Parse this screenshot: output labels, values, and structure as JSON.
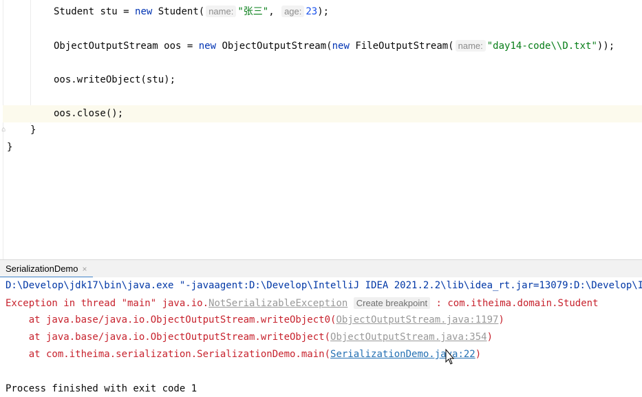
{
  "editor": {
    "line1": {
      "indent": "    ",
      "type": "Student",
      "var": " stu = ",
      "kw_new": "new",
      "ctor": " Student(",
      "hint_name": "name:",
      "arg1": "\"张三\"",
      "comma": ",",
      "hint_age": "age:",
      "arg2": "23",
      "end": ");"
    },
    "line2": {
      "type": "ObjectOutputStream oos = ",
      "kw_new1": "new",
      "ctor1": " ObjectOutputStream(",
      "kw_new2": "new",
      "ctor2": " FileOutputStream(",
      "hint_name": "name:",
      "arg": "\"day14-code\\\\D.txt\"",
      "end": "));"
    },
    "line3": "oos.writeObject(stu);",
    "line4": "oos.close();",
    "brace_inner": "}",
    "brace_outer": "}"
  },
  "toolwindow": {
    "tab_label": "SerializationDemo",
    "tab_close": "×"
  },
  "console": {
    "cmd_line": "D:\\Develop\\jdk17\\bin\\java.exe \"-javaagent:D:\\Develop\\IntelliJ IDEA 2021.2.2\\lib\\idea_rt.jar=13079:D:\\Develop\\I",
    "exception_prefix": "Exception in thread \"main\" java.io.",
    "exception_class": "NotSerializableException",
    "create_breakpoint": "Create breakpoint",
    "exception_suffix": " : com.itheima.domain.Student",
    "trace1_prefix": "    at java.base/java.io.ObjectOutputStream.writeObject0(",
    "trace1_link": "ObjectOutputStream.java:1197",
    "trace2_prefix": "    at java.base/java.io.ObjectOutputStream.writeObject(",
    "trace2_link": "ObjectOutputStream.java:354",
    "trace3_prefix": "    at com.itheima.serialization.SerializationDemo.main(",
    "trace3_link": "SerializationDemo.java:22",
    "close_paren": ")",
    "exit_line": "Process finished with exit code 1"
  }
}
